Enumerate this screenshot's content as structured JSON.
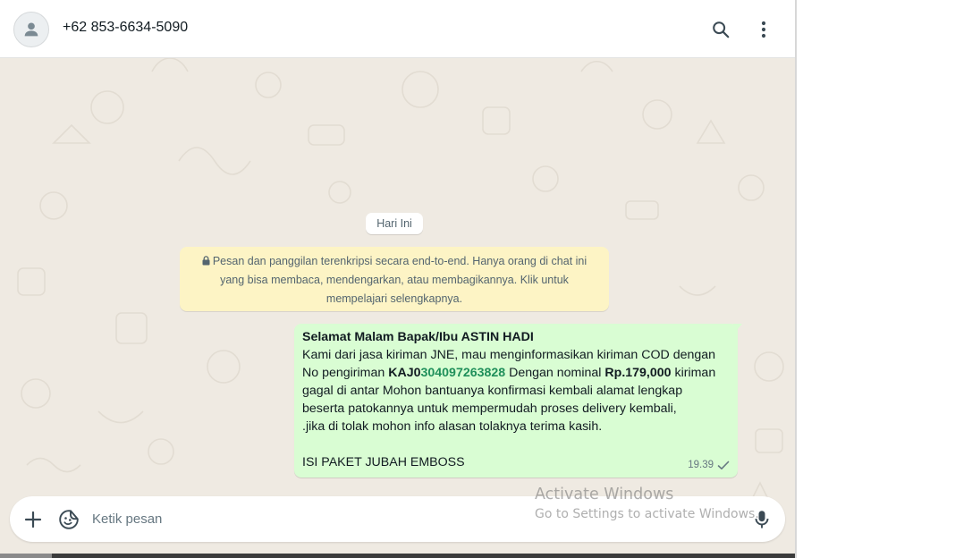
{
  "header": {
    "contact_name": "+62 853-6634-5090",
    "avatar_icon": "default-user-icon",
    "search_icon": "search-icon",
    "menu_icon": "kebab-menu-icon"
  },
  "date_chip": "Hari Ini",
  "encryption_notice": {
    "icon": "lock-icon",
    "line1": "Pesan dan panggilan terenkripsi secara end-to-end. Hanya orang di chat ini",
    "line2": "yang bisa membaca, mendengarkan, atau membagikannya. Klik untuk",
    "line3": "mempelajari selengkapnya."
  },
  "message": {
    "greeting": "Selamat Malam Bapak/Ibu ASTIN HADI",
    "line1": "Kami dari jasa kiriman JNE, mau menginformasikan kiriman COD dengan",
    "line2_prefix": "No pengiriman ",
    "tracking_prefix": "KAJ0",
    "tracking_number": "304097263828",
    "line2_mid": " Dengan nominal ",
    "amount": "Rp.179,000",
    "line2_suffix": " kiriman",
    "line3": "gagal di antar Mohon bantuanya konfirmasi kembali alamat lengkap",
    "line4": "beserta patokannya untuk mempermudah proses delivery kembali,",
    "line5": " .jika di tolak mohon info alasan tolaknya terima kasih.",
    "line6": "ISI PAKET JUBAH EMBOSS",
    "time": "19.39",
    "status_icon": "single-check-icon"
  },
  "composer": {
    "attach_icon": "plus-icon",
    "sticker_icon": "sticker-icon",
    "placeholder": "Ketik pesan",
    "mic_icon": "microphone-icon"
  },
  "watermark": {
    "title": "Activate Windows",
    "subtitle": "Go to Settings to activate Windows."
  },
  "colors": {
    "chat_background": "#efeae2",
    "outgoing_bubble": "#d9fdd3",
    "notice_background": "#fdf4c5",
    "tracking_link": "#1f8f5a"
  }
}
